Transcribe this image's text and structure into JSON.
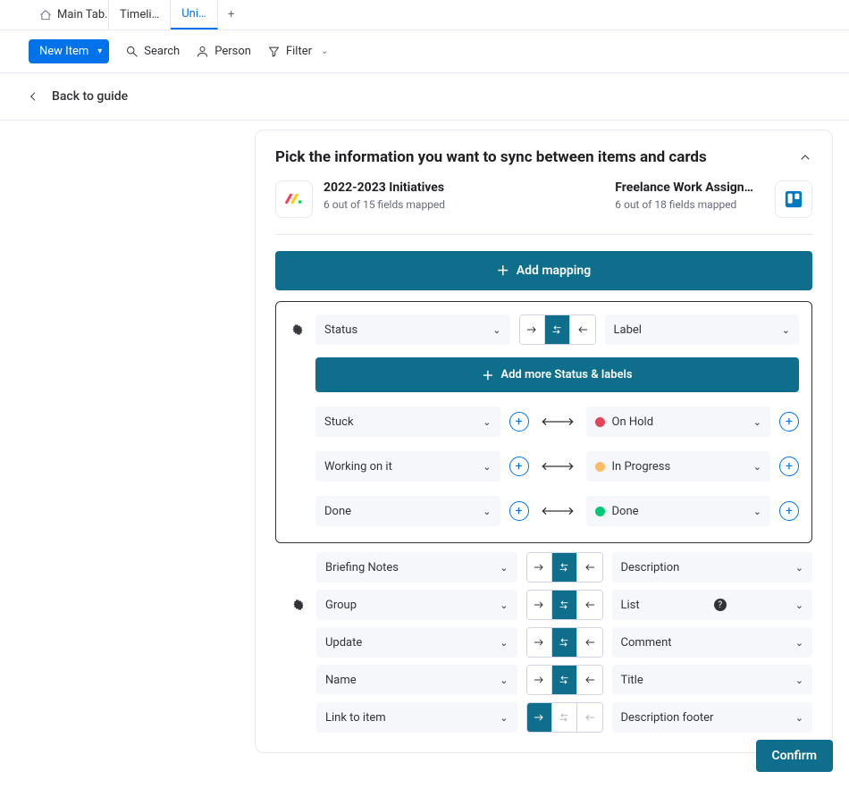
{
  "tabs": {
    "items": [
      "Main Tab…",
      "Timeli…",
      "Uni…"
    ],
    "active_index": 2
  },
  "toolbar": {
    "new_item": "New Item",
    "search": "Search",
    "person": "Person",
    "filter": "Filter"
  },
  "back_label": "Back to guide",
  "panel": {
    "title": "Pick the information you want to sync between items and cards",
    "left": {
      "name": "2022-2023 Initiatives",
      "sub": "6 out of 15 fields mapped"
    },
    "right": {
      "name": "Freelance Work Assign…",
      "sub": "6 out of 18 fields mapped"
    },
    "add_mapping": "Add mapping",
    "status_block": {
      "left_field": "Status",
      "right_field": "Label",
      "add_more": "Add more Status & labels",
      "pairs": [
        {
          "left": "Stuck",
          "right": "On Hold",
          "dot": "red"
        },
        {
          "left": "Working on it",
          "right": "In Progress",
          "dot": "yellow"
        },
        {
          "left": "Done",
          "right": "Done",
          "dot": "green"
        }
      ]
    },
    "mappings": [
      {
        "left": "Briefing Notes",
        "right": "Description",
        "gear": false,
        "dir": "both",
        "right_q": false
      },
      {
        "left": "Group",
        "right": "List",
        "gear": true,
        "dir": "both",
        "right_q": true
      },
      {
        "left": "Update",
        "right": "Comment",
        "gear": false,
        "dir": "both",
        "right_q": false
      },
      {
        "left": "Name",
        "right": "Title",
        "gear": false,
        "dir": "both",
        "right_q": false
      },
      {
        "left": "Link to item",
        "right": "Description footer",
        "gear": false,
        "dir": "right",
        "right_q": false
      }
    ]
  },
  "confirm_label": "Confirm",
  "colors": {
    "primary": "#0073ea",
    "teal": "#0f6e8c"
  }
}
